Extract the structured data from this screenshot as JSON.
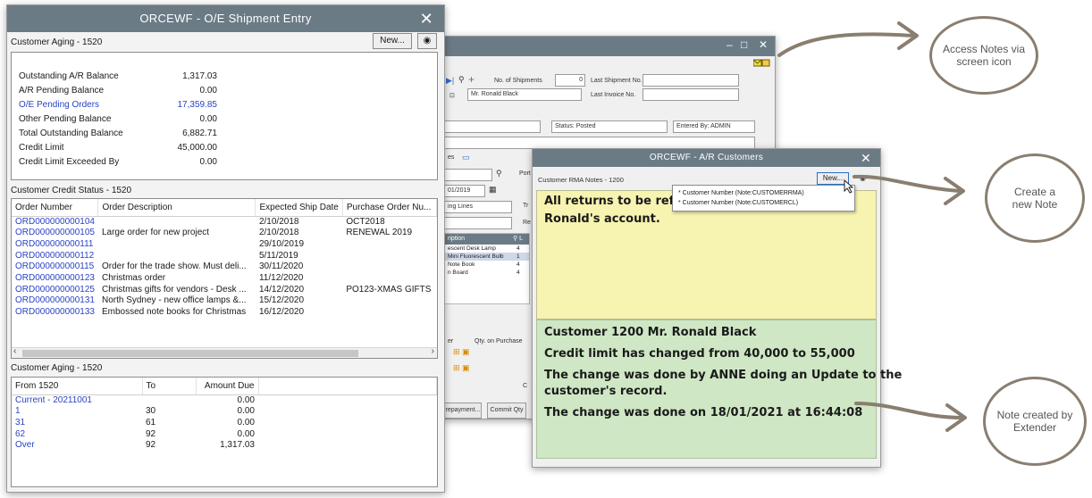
{
  "w1": {
    "title": "ORCEWF - O/E Shipment Entry",
    "close": "✕",
    "aging_top_label": "Customer Aging - 1520",
    "new_button": "New...",
    "options_icon": "◉",
    "balances": [
      {
        "label": "Outstanding A/R Balance",
        "value": "1,317.03",
        "link": false
      },
      {
        "label": "A/R Pending Balance",
        "value": "0.00",
        "link": false
      },
      {
        "label": "O/E Pending Orders",
        "value": "17,359.85",
        "link": true
      },
      {
        "label": "Other Pending Balance",
        "value": "0.00",
        "link": false
      },
      {
        "label": "Total Outstanding Balance",
        "value": "6,882.71",
        "link": false
      },
      {
        "label": "Credit Limit",
        "value": "45,000.00",
        "link": false
      },
      {
        "label": "Credit Limit Exceeded By",
        "value": "0.00",
        "link": false
      }
    ],
    "credit_status_label": "Customer Credit Status - 1520",
    "orders_columns": [
      "Order Number",
      "Order Description",
      "Expected Ship Date",
      "Purchase Order Nu..."
    ],
    "orders": [
      [
        "ORD000000000104",
        "",
        "2/10/2018",
        "OCT2018"
      ],
      [
        "ORD000000000105",
        "Large order for new project",
        "2/10/2018",
        "RENEWAL 2019"
      ],
      [
        "ORD000000000111",
        "",
        "29/10/2019",
        ""
      ],
      [
        "ORD000000000112",
        "",
        "5/11/2019",
        ""
      ],
      [
        "ORD000000000115",
        "Order for the trade show.  Must deli...",
        "30/11/2020",
        ""
      ],
      [
        "ORD000000000123",
        "Christmas order",
        "11/12/2020",
        ""
      ],
      [
        "ORD000000000125",
        "Christmas gifts for vendors - Desk ...",
        "14/12/2020",
        "PO123-XMAS GIFTS"
      ],
      [
        "ORD000000000131",
        "North Sydney - new office lamps &...",
        "15/12/2020",
        ""
      ],
      [
        "ORD000000000133",
        "Embossed note books for Christmas",
        "16/12/2020",
        ""
      ]
    ],
    "aging_bottom_label": "Customer Aging - 1520",
    "aging_columns": [
      "From 1520",
      "To",
      "Amount Due"
    ],
    "aging": [
      [
        "Current - 20211001",
        "",
        "0.00"
      ],
      [
        "1",
        "30",
        "0.00"
      ],
      [
        "31",
        "61",
        "0.00"
      ],
      [
        "62",
        "92",
        "0.00"
      ],
      [
        "Over",
        "92",
        "1,317.03"
      ]
    ]
  },
  "w2": {
    "minimize": "–",
    "maximize": "□",
    "close": "✕",
    "no_of_shipments_label": "No. of Shipments",
    "no_of_shipments_value": "0",
    "last_shipment_label": "Last Shipment No.",
    "customer_name": "Mr. Ronald Black",
    "last_invoice_label": "Last Invoice No.",
    "status": "Status: Posted",
    "entered_by": "Entered By: ADMIN",
    "date_value": "01/2019",
    "lines_label": "ing Lines",
    "items_header": "ription",
    "items": [
      [
        "escent Desk Lamp",
        "4"
      ],
      [
        "Mini Fluorescent Bulb",
        "1"
      ],
      [
        "Note Book",
        "4"
      ],
      [
        "n Board",
        "4"
      ]
    ],
    "qty_label": "Qty. on Purchase",
    "tax_label": "es",
    "port_label": "Port",
    "tr_label": "Tr",
    "re_label": "Re",
    "er_label": "er",
    "c_label": "C",
    "prepayment_button": "repayment...",
    "commit_qty_button": "Commit Qty"
  },
  "w3": {
    "title": "ORCEWF - A/R Customers",
    "close": "✕",
    "notes_label": "Customer RMA Notes - 1200",
    "new_button": "New...",
    "dropdown": [
      "* Customer Number (Note:CUSTOMERRMA)",
      "* Customer Number (Note:CUSTOMERCL)"
    ],
    "yellow_lines": [
      "All returns to be refunded",
      "Ronald's account."
    ],
    "green_lines": [
      "Customer 1200 Mr. Ronald Black",
      "Credit limit has changed from 40,000 to 55,000",
      "The change was done by ANNE doing an Update to the",
      "customer's record.",
      "The change was done on 18/01/2021 at 16:44:08"
    ]
  },
  "callouts": {
    "access_notes": "Access Notes via screen icon",
    "create_note": "Create a new Note",
    "note_created": "Note created by Extender"
  },
  "colors": {
    "titlebar": "#6b7b86",
    "link_blue": "#2a43c4",
    "note_yellow": "#f7f3b0",
    "note_green": "#cfe7c4",
    "callout_stroke": "#8a7e70"
  }
}
